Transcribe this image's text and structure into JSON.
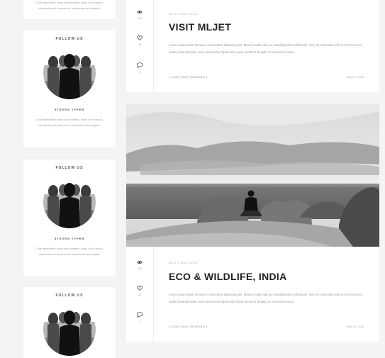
{
  "sidebar": {
    "widget0": {
      "text": "Cras imperdiet in sem sed sodales. Nunc ut ex lectus, elementum et rhoncus ac, accumsan sed sapien."
    },
    "widget1": {
      "title": "FOLLOW US",
      "name": "STEVEN TYPER",
      "text": "Cras imperdiet in sem sed sodales. Nunc ut ex lectus, elementum et rhoncus ac, accumsan sed sapien."
    },
    "widget2": {
      "title": "FOLLOW US",
      "name": "STEVEN TYPER",
      "text": "Cras imperdiet in sem sed sodales. Nunc ut ex lectus, elementum et rhoncus ac, accumsan sed sapien."
    },
    "widget3": {
      "title": "FOLLOW US"
    }
  },
  "posts": {
    "post1": {
      "views": "310",
      "likes": "40",
      "comments": "0",
      "category": "DESTINATIONS",
      "title": "VISIT MLJET",
      "excerpt": "Lorem ipsum dolor sit amet, consectetur adipiscing elit. Mauris mattis odio ac erat dignissim sollicitudin. Sed vel commodo velit, in rhoncus eros. Nulla id blandit ligula. Sed consectetur ligula sed neque hendrerit feugiat. In fermentum lacus.",
      "more": "[ CONTINUE READING ]",
      "date": "May 21, 2016"
    },
    "post2": {
      "views": "440",
      "likes": "26",
      "comments": "0",
      "category": "DESTINATIONS",
      "title": "ECO & WILDLIFE, INDIA",
      "excerpt": "Lorem ipsum dolor sit amet, consectetur adipiscing elit. Mauris mattis odio ac erat dignissim sollicitudin. Sed vel commodo velit, in rhoncus eros. Nulla id blandit ligula. Sed consectetur ligula sed neque hendrerit feugiat. In fermentum lacus.",
      "more": "[ CONTINUE READING ]",
      "date": "May 18, 2016"
    }
  }
}
